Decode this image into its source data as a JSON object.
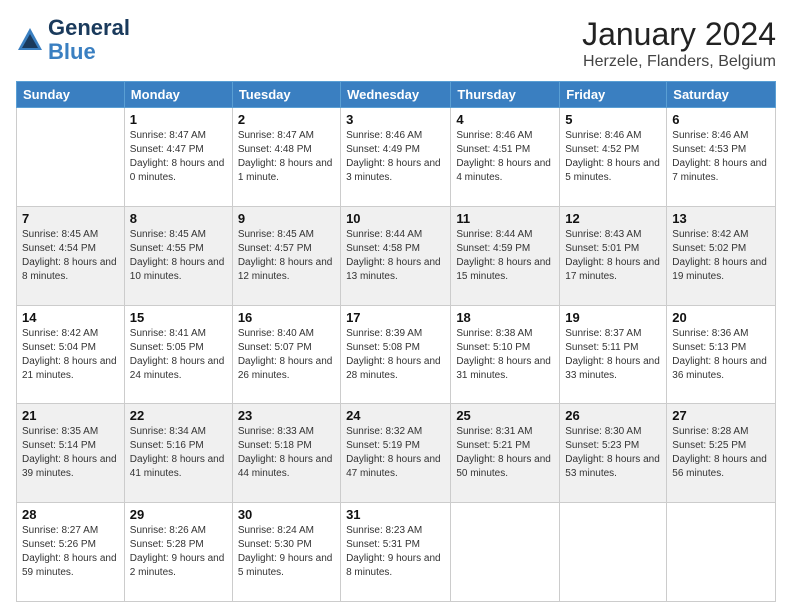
{
  "logo": {
    "line1": "General",
    "line2": "Blue"
  },
  "title": "January 2024",
  "subtitle": "Herzele, Flanders, Belgium",
  "days_of_week": [
    "Sunday",
    "Monday",
    "Tuesday",
    "Wednesday",
    "Thursday",
    "Friday",
    "Saturday"
  ],
  "weeks": [
    [
      {
        "day": "",
        "sunrise": "",
        "sunset": "",
        "daylight": "",
        "empty": true
      },
      {
        "day": "1",
        "sunrise": "Sunrise: 8:47 AM",
        "sunset": "Sunset: 4:47 PM",
        "daylight": "Daylight: 8 hours and 0 minutes."
      },
      {
        "day": "2",
        "sunrise": "Sunrise: 8:47 AM",
        "sunset": "Sunset: 4:48 PM",
        "daylight": "Daylight: 8 hours and 1 minute."
      },
      {
        "day": "3",
        "sunrise": "Sunrise: 8:46 AM",
        "sunset": "Sunset: 4:49 PM",
        "daylight": "Daylight: 8 hours and 3 minutes."
      },
      {
        "day": "4",
        "sunrise": "Sunrise: 8:46 AM",
        "sunset": "Sunset: 4:51 PM",
        "daylight": "Daylight: 8 hours and 4 minutes."
      },
      {
        "day": "5",
        "sunrise": "Sunrise: 8:46 AM",
        "sunset": "Sunset: 4:52 PM",
        "daylight": "Daylight: 8 hours and 5 minutes."
      },
      {
        "day": "6",
        "sunrise": "Sunrise: 8:46 AM",
        "sunset": "Sunset: 4:53 PM",
        "daylight": "Daylight: 8 hours and 7 minutes."
      }
    ],
    [
      {
        "day": "7",
        "sunrise": "Sunrise: 8:45 AM",
        "sunset": "Sunset: 4:54 PM",
        "daylight": "Daylight: 8 hours and 8 minutes.",
        "shaded": true
      },
      {
        "day": "8",
        "sunrise": "Sunrise: 8:45 AM",
        "sunset": "Sunset: 4:55 PM",
        "daylight": "Daylight: 8 hours and 10 minutes.",
        "shaded": true
      },
      {
        "day": "9",
        "sunrise": "Sunrise: 8:45 AM",
        "sunset": "Sunset: 4:57 PM",
        "daylight": "Daylight: 8 hours and 12 minutes.",
        "shaded": true
      },
      {
        "day": "10",
        "sunrise": "Sunrise: 8:44 AM",
        "sunset": "Sunset: 4:58 PM",
        "daylight": "Daylight: 8 hours and 13 minutes.",
        "shaded": true
      },
      {
        "day": "11",
        "sunrise": "Sunrise: 8:44 AM",
        "sunset": "Sunset: 4:59 PM",
        "daylight": "Daylight: 8 hours and 15 minutes.",
        "shaded": true
      },
      {
        "day": "12",
        "sunrise": "Sunrise: 8:43 AM",
        "sunset": "Sunset: 5:01 PM",
        "daylight": "Daylight: 8 hours and 17 minutes.",
        "shaded": true
      },
      {
        "day": "13",
        "sunrise": "Sunrise: 8:42 AM",
        "sunset": "Sunset: 5:02 PM",
        "daylight": "Daylight: 8 hours and 19 minutes.",
        "shaded": true
      }
    ],
    [
      {
        "day": "14",
        "sunrise": "Sunrise: 8:42 AM",
        "sunset": "Sunset: 5:04 PM",
        "daylight": "Daylight: 8 hours and 21 minutes."
      },
      {
        "day": "15",
        "sunrise": "Sunrise: 8:41 AM",
        "sunset": "Sunset: 5:05 PM",
        "daylight": "Daylight: 8 hours and 24 minutes."
      },
      {
        "day": "16",
        "sunrise": "Sunrise: 8:40 AM",
        "sunset": "Sunset: 5:07 PM",
        "daylight": "Daylight: 8 hours and 26 minutes."
      },
      {
        "day": "17",
        "sunrise": "Sunrise: 8:39 AM",
        "sunset": "Sunset: 5:08 PM",
        "daylight": "Daylight: 8 hours and 28 minutes."
      },
      {
        "day": "18",
        "sunrise": "Sunrise: 8:38 AM",
        "sunset": "Sunset: 5:10 PM",
        "daylight": "Daylight: 8 hours and 31 minutes."
      },
      {
        "day": "19",
        "sunrise": "Sunrise: 8:37 AM",
        "sunset": "Sunset: 5:11 PM",
        "daylight": "Daylight: 8 hours and 33 minutes."
      },
      {
        "day": "20",
        "sunrise": "Sunrise: 8:36 AM",
        "sunset": "Sunset: 5:13 PM",
        "daylight": "Daylight: 8 hours and 36 minutes."
      }
    ],
    [
      {
        "day": "21",
        "sunrise": "Sunrise: 8:35 AM",
        "sunset": "Sunset: 5:14 PM",
        "daylight": "Daylight: 8 hours and 39 minutes.",
        "shaded": true
      },
      {
        "day": "22",
        "sunrise": "Sunrise: 8:34 AM",
        "sunset": "Sunset: 5:16 PM",
        "daylight": "Daylight: 8 hours and 41 minutes.",
        "shaded": true
      },
      {
        "day": "23",
        "sunrise": "Sunrise: 8:33 AM",
        "sunset": "Sunset: 5:18 PM",
        "daylight": "Daylight: 8 hours and 44 minutes.",
        "shaded": true
      },
      {
        "day": "24",
        "sunrise": "Sunrise: 8:32 AM",
        "sunset": "Sunset: 5:19 PM",
        "daylight": "Daylight: 8 hours and 47 minutes.",
        "shaded": true
      },
      {
        "day": "25",
        "sunrise": "Sunrise: 8:31 AM",
        "sunset": "Sunset: 5:21 PM",
        "daylight": "Daylight: 8 hours and 50 minutes.",
        "shaded": true
      },
      {
        "day": "26",
        "sunrise": "Sunrise: 8:30 AM",
        "sunset": "Sunset: 5:23 PM",
        "daylight": "Daylight: 8 hours and 53 minutes.",
        "shaded": true
      },
      {
        "day": "27",
        "sunrise": "Sunrise: 8:28 AM",
        "sunset": "Sunset: 5:25 PM",
        "daylight": "Daylight: 8 hours and 56 minutes.",
        "shaded": true
      }
    ],
    [
      {
        "day": "28",
        "sunrise": "Sunrise: 8:27 AM",
        "sunset": "Sunset: 5:26 PM",
        "daylight": "Daylight: 8 hours and 59 minutes."
      },
      {
        "day": "29",
        "sunrise": "Sunrise: 8:26 AM",
        "sunset": "Sunset: 5:28 PM",
        "daylight": "Daylight: 9 hours and 2 minutes."
      },
      {
        "day": "30",
        "sunrise": "Sunrise: 8:24 AM",
        "sunset": "Sunset: 5:30 PM",
        "daylight": "Daylight: 9 hours and 5 minutes."
      },
      {
        "day": "31",
        "sunrise": "Sunrise: 8:23 AM",
        "sunset": "Sunset: 5:31 PM",
        "daylight": "Daylight: 9 hours and 8 minutes."
      },
      {
        "day": "",
        "sunrise": "",
        "sunset": "",
        "daylight": "",
        "empty": true
      },
      {
        "day": "",
        "sunrise": "",
        "sunset": "",
        "daylight": "",
        "empty": true
      },
      {
        "day": "",
        "sunrise": "",
        "sunset": "",
        "daylight": "",
        "empty": true
      }
    ]
  ]
}
